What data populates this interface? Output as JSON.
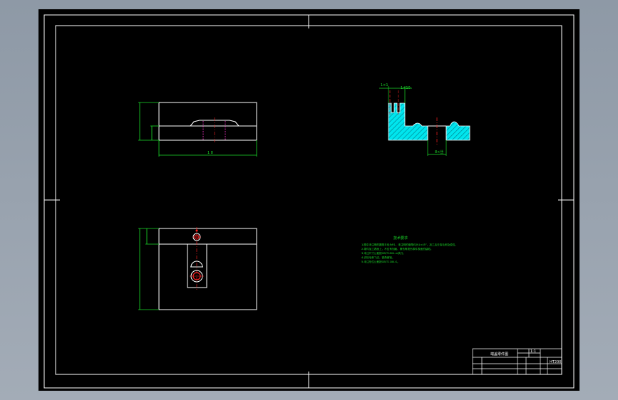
{
  "colors": {
    "background_outer": "#9aa4b0",
    "sheet": "#000000",
    "border": "#ffffff",
    "dimension": "#1bdc2a",
    "hatch": "#00e5ee",
    "centerline": "#ff2020",
    "hidden_line": "#ff33cc"
  },
  "front_view": {
    "dim_length": "1 8"
  },
  "section_view": {
    "dim_left": "1×1",
    "dim_right": "1×10",
    "dim_bottom": "8×丝"
  },
  "technical_notes": {
    "title": "技术要求",
    "lines": [
      "1.图中未注明的圆角半径为R1，未注明的倒角均为1×45°，加工后去除毛刺及锐边。",
      "2.零件加工表面上，不应有划痕、擦伤等损伤零件表面的缺陷。",
      "3.未注尺寸公差按GB/T1804-m执行。",
      "4.去除毛刺飞边，锐角倒钝。",
      "5.未注形位公差按GB/T1184-K。"
    ]
  },
  "title_block": {
    "part_name": "端盖零件图",
    "scale": "1:1",
    "material": "HT200"
  }
}
